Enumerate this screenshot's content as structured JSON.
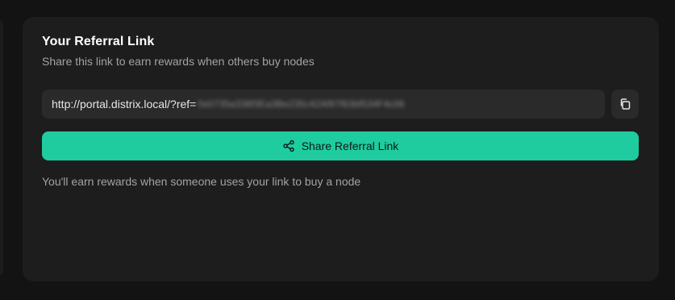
{
  "referral": {
    "title": "Your Referral Link",
    "subtitle": "Share this link to earn rewards when others buy nodes",
    "link_visible": "http://portal.distrix.local/?ref=",
    "link_redacted": "0x0735a338f3Ea3Be235c42Af97f63bf534F4c06",
    "copy_icon": "copy-icon",
    "share_icon": "share-icon",
    "share_label": "Share Referral Link",
    "note": "You'll earn rewards when someone uses your link to buy a node"
  },
  "colors": {
    "background": "#131313",
    "card": "#1d1d1d",
    "field": "#2a2a2a",
    "accent": "#1ecc9f"
  }
}
